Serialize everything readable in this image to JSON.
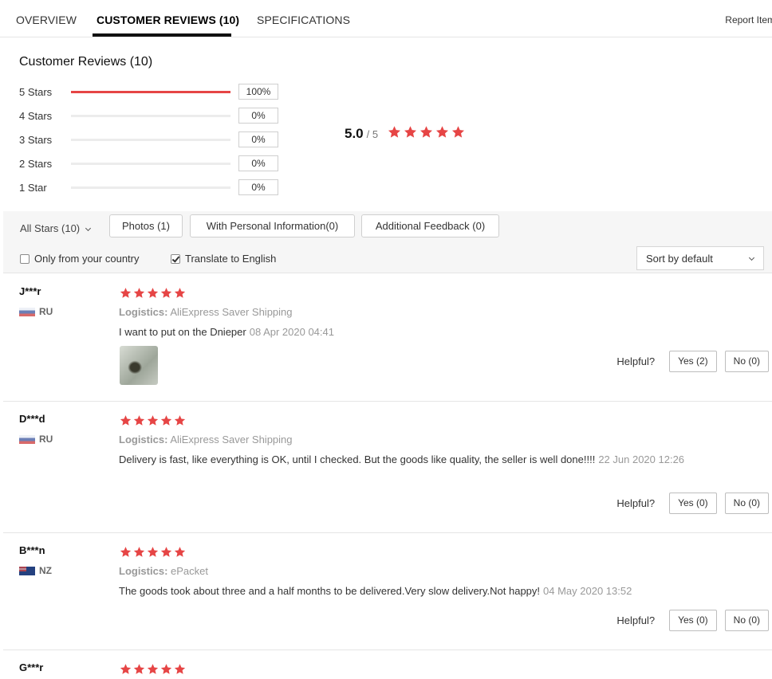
{
  "tabs": [
    {
      "label": "OVERVIEW"
    },
    {
      "label": "CUSTOMER REVIEWS (10)"
    },
    {
      "label": "SPECIFICATIONS"
    }
  ],
  "report_label": "Report Item",
  "summary": {
    "title": "Customer Reviews (10)",
    "rows": [
      {
        "label": "5 Stars",
        "percent": "100%",
        "fraction": 1.0
      },
      {
        "label": "4 Stars",
        "percent": "0%",
        "fraction": 0
      },
      {
        "label": "3 Stars",
        "percent": "0%",
        "fraction": 0
      },
      {
        "label": "2 Stars",
        "percent": "0%",
        "fraction": 0
      },
      {
        "label": "1 Star",
        "percent": "0%",
        "fraction": 0
      }
    ],
    "average": "5.0",
    "out_of": "/ 5",
    "average_stars": 5
  },
  "filters": {
    "all_stars": "All Stars (10)",
    "photos": "Photos (1)",
    "personal": "With Personal Information(0)",
    "additional": "Additional Feedback (0)",
    "only_country": "Only from your country",
    "translate": "Translate to English",
    "sort": "Sort by default"
  },
  "colors": {
    "accent": "#e64545"
  },
  "helpful_label": "Helpful?",
  "logistics_label": "Logistics:",
  "reviews": [
    {
      "name": "J***r",
      "country": "RU",
      "stars": 5,
      "logistics": "AliExpress Saver Shipping",
      "text": "I want to put on the Dnieper",
      "date": "08 Apr 2020 04:41",
      "yes": "Yes (2)",
      "no": "No (0)"
    },
    {
      "name": "D***d",
      "country": "RU",
      "stars": 5,
      "logistics": "AliExpress Saver Shipping",
      "text": "Delivery is fast, like everything is OK, until I checked. But the goods like quality, the seller is well done!!!!",
      "date": "22 Jun 2020 12:26",
      "yes": "Yes (0)",
      "no": "No (0)"
    },
    {
      "name": "B***n",
      "country": "NZ",
      "stars": 5,
      "logistics": "ePacket",
      "text": "The goods took about three and a half months to be delivered.Very slow delivery.Not happy!",
      "date": "04 May 2020 13:52",
      "yes": "Yes (0)",
      "no": "No (0)"
    },
    {
      "name": "G***r",
      "stars": 5
    }
  ]
}
